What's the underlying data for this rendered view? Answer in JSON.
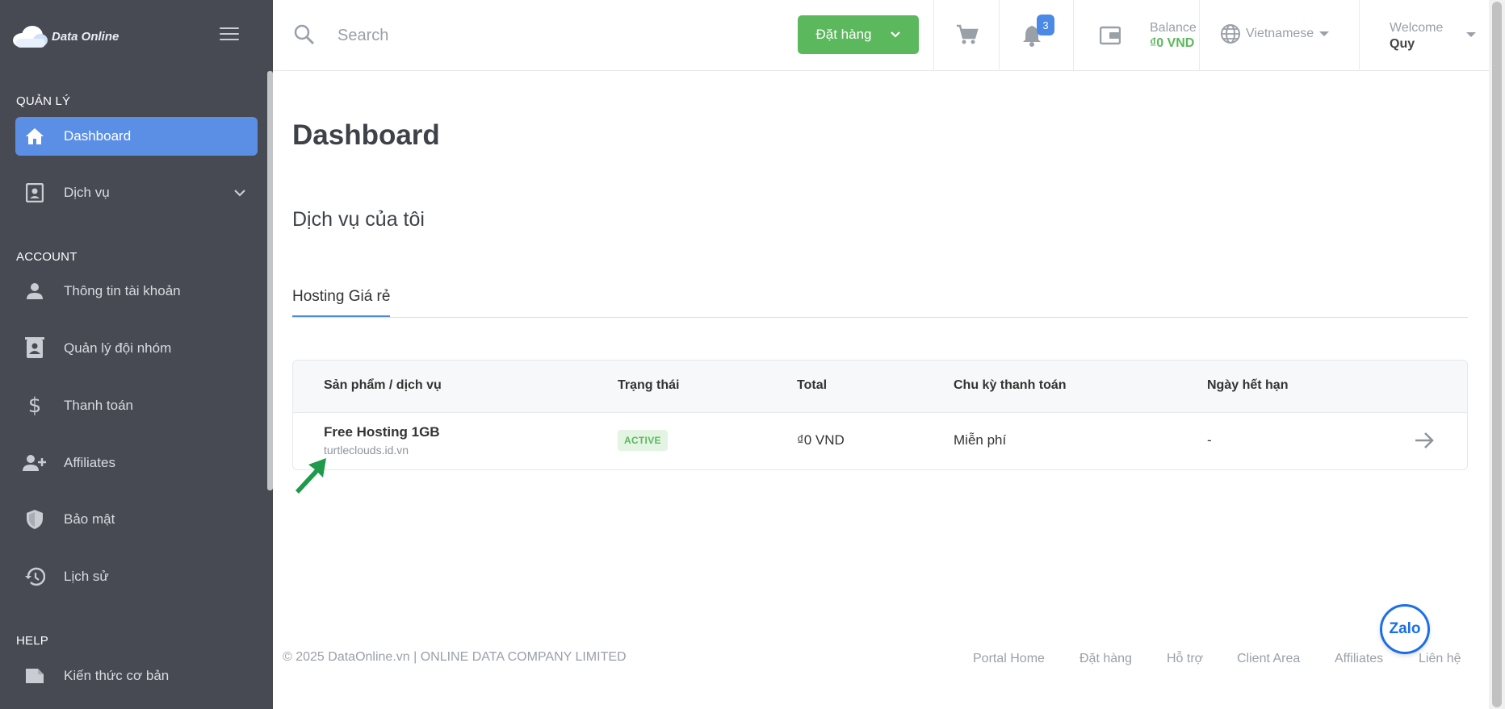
{
  "brand": {
    "name": "Data Online"
  },
  "sidebar": {
    "sections": [
      {
        "title": "QUẢN LÝ"
      },
      {
        "title": "ACCOUNT"
      },
      {
        "title": "HELP"
      }
    ],
    "items": [
      {
        "label": "Dashboard",
        "icon": "home-icon",
        "active": true
      },
      {
        "label": "Dịch vụ",
        "icon": "contact-card-icon"
      },
      {
        "label": "Thông tin tài khoản",
        "icon": "user-icon"
      },
      {
        "label": "Quản lý đội nhóm",
        "icon": "team-icon"
      },
      {
        "label": "Thanh toán",
        "icon": "dollar-icon"
      },
      {
        "label": "Affiliates",
        "icon": "user-plus-icon"
      },
      {
        "label": "Bảo mật",
        "icon": "shield-icon"
      },
      {
        "label": "Lịch sử",
        "icon": "history-icon"
      },
      {
        "label": "Kiến thức cơ bản",
        "icon": "book-icon"
      }
    ]
  },
  "topbar": {
    "search_placeholder": "Search",
    "order_label": "Đặt hàng",
    "notification_count": "3",
    "balance_label": "Balance",
    "balance_value": "₫0 VND",
    "language": "Vietnamese",
    "welcome_label": "Welcome",
    "user_name": "Quy"
  },
  "main": {
    "page_title": "Dashboard",
    "section_title": "Dịch vụ của tôi",
    "tabs": [
      {
        "label": "Hosting Giá rẻ"
      }
    ],
    "table": {
      "headers": [
        "Sản phẩm / dịch vụ",
        "Trạng thái",
        "Total",
        "Chu kỳ thanh toán",
        "Ngày hết hạn"
      ],
      "rows": [
        {
          "product": "Free Hosting 1GB",
          "domain": "turtleclouds.id.vn",
          "status": "ACTIVE",
          "total": "₫0 VND",
          "cycle": "Miễn phí",
          "expiry": "-"
        }
      ]
    }
  },
  "footer": {
    "copyright": "© 2025 DataOnline.vn | ONLINE DATA COMPANY LIMITED",
    "links": [
      "Portal Home",
      "Đặt hàng",
      "Hỗ trợ",
      "Client Area",
      "Affiliates",
      "Liên hệ"
    ]
  },
  "zalo": {
    "label": "Zalo"
  },
  "colors": {
    "sidebar": "#474a52",
    "accent": "#5b8fe6",
    "success": "#5cb85c"
  }
}
